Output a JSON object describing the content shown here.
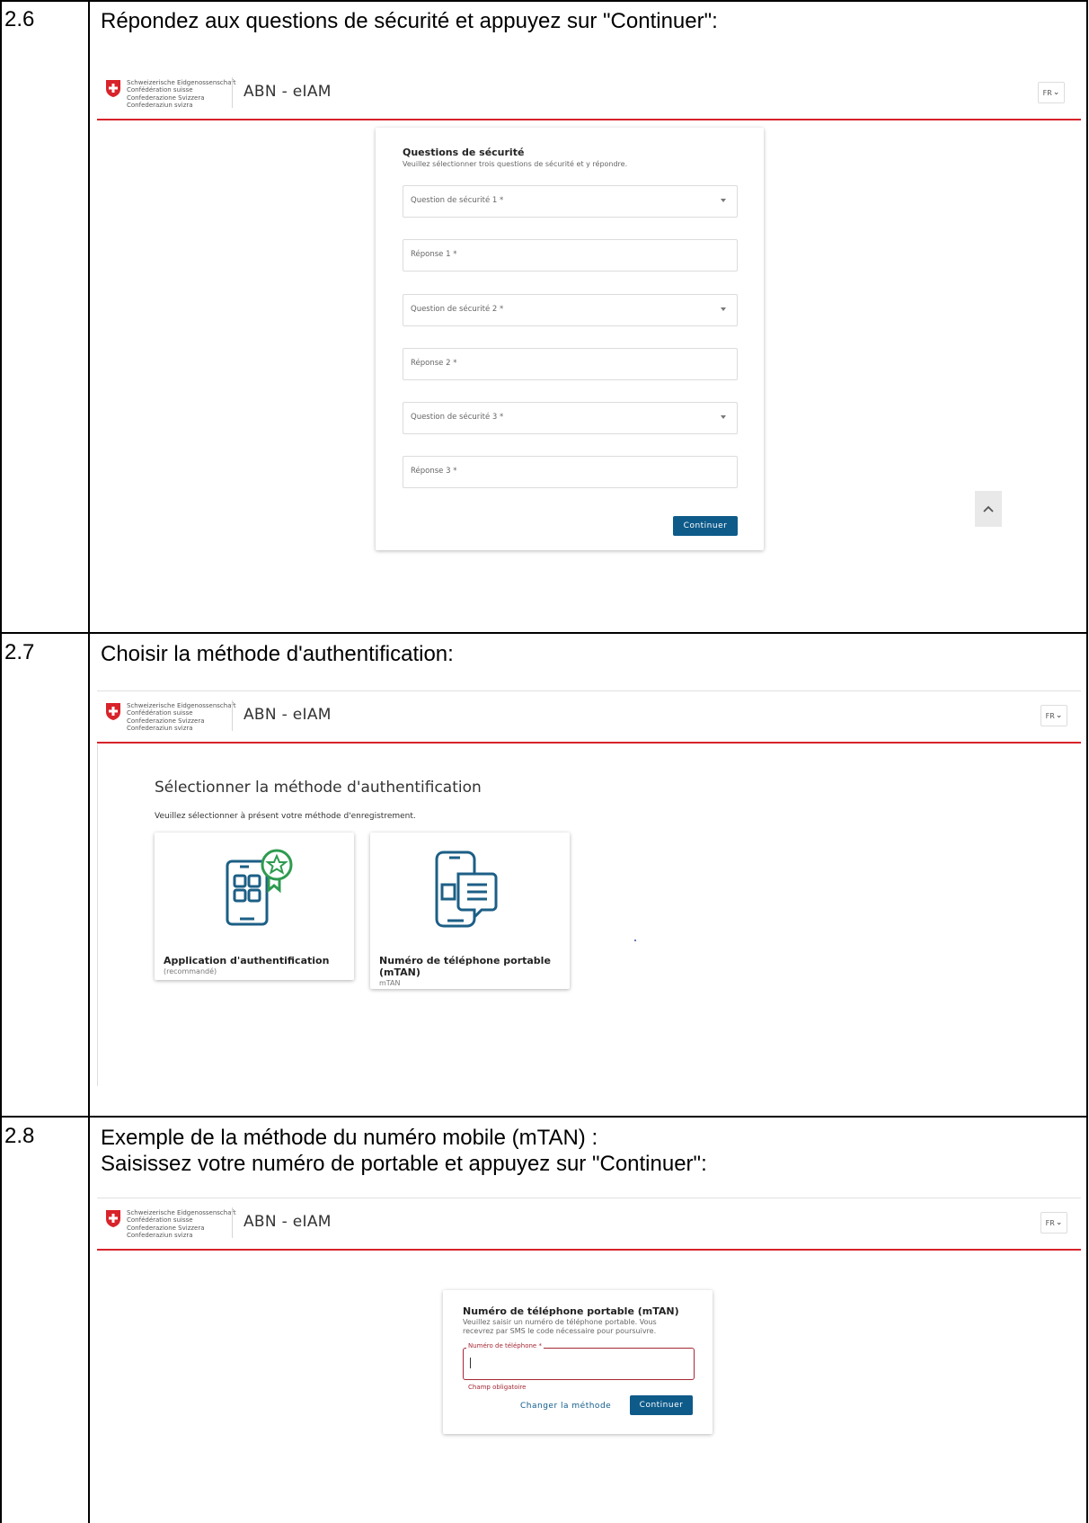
{
  "steps": [
    {
      "number": "2.6",
      "title": "Répondez aux questions de sécurité et appuyez sur \"Continuer\":",
      "screen": {
        "confederation": [
          "Schweizerische Eidgenossenschaft",
          "Confédération suisse",
          "Confederazione Svizzera",
          "Confederaziun svizra"
        ],
        "app_name": "ABN - eIAM",
        "language": "FR",
        "card_title": "Questions de sécurité",
        "card_subtitle": "Veuillez sélectionner trois questions de sécurité et y répondre.",
        "fields": [
          {
            "placeholder": "Question de sécurité 1 *",
            "type": "select"
          },
          {
            "placeholder": "Réponse 1 *",
            "type": "input"
          },
          {
            "placeholder": "Question de sécurité 2 *",
            "type": "select"
          },
          {
            "placeholder": "Réponse 2 *",
            "type": "input"
          },
          {
            "placeholder": "Question de sécurité 3 *",
            "type": "select"
          },
          {
            "placeholder": "Réponse 3 *",
            "type": "input"
          }
        ],
        "continue_label": "Continuer"
      }
    },
    {
      "number": "2.7",
      "title": "Choisir la méthode d'authentification:",
      "screen": {
        "confederation": [
          "Schweizerische Eidgenossenschaft",
          "Confédération suisse",
          "Confederazione Svizzera",
          "Confederaziun svizra"
        ],
        "app_name": "ABN - eIAM",
        "language": "FR",
        "heading": "Sélectionner la méthode d'authentification",
        "subheading": "Veuillez sélectionner à présent votre méthode d'enregistrement.",
        "methods": [
          {
            "title": "Application d'authentification",
            "subtitle": "(recommandé)",
            "icon": "authenticator-app-icon"
          },
          {
            "title_line1": "Numéro de téléphone portable",
            "title_line2": "(mTAN)",
            "subtitle": "mTAN",
            "icon": "mobile-sms-icon"
          }
        ]
      }
    },
    {
      "number": "2.8",
      "title_line1": "Exemple de la méthode du numéro mobile (mTAN) :",
      "title_line2": "Saisissez votre numéro de portable et appuyez sur \"Continuer\":",
      "screen": {
        "confederation": [
          "Schweizerische Eidgenossenschaft",
          "Confédération suisse",
          "Confederazione Svizzera",
          "Confederaziun svizra"
        ],
        "app_name": "ABN - eIAM",
        "language": "FR",
        "card_title": "Numéro de téléphone portable (mTAN)",
        "card_text_line1": "Veuillez saisir un numéro de téléphone portable. Vous",
        "card_text_line2": "recevrez par SMS le code nécessaire pour poursuivre.",
        "phone_label": "Numéro de téléphone *",
        "error_message": "Champ obligatoire",
        "change_method_label": "Changer la méthode",
        "continue_label": "Continuer"
      }
    }
  ],
  "colors": {
    "swiss_red": "#d8232a",
    "primary_blue": "#0e5b8a",
    "icon_blue": "#1c5f86",
    "icon_green": "#2e9b4f",
    "error_red": "#a52834"
  }
}
